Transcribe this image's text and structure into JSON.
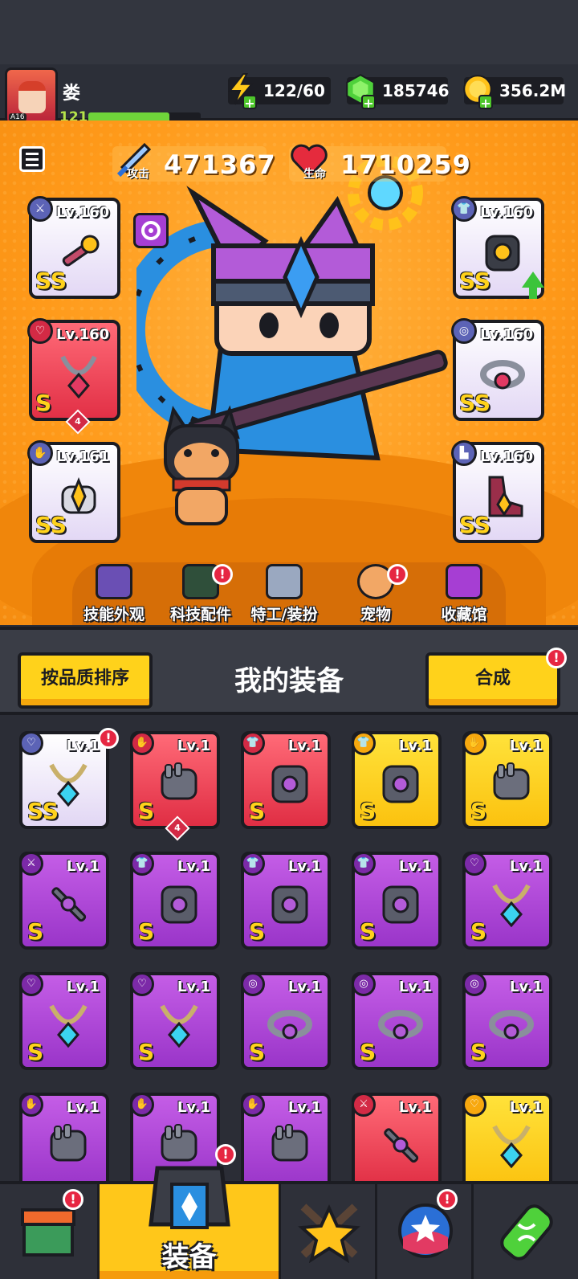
{
  "player": {
    "name": "娄",
    "level": "121",
    "avatar_badge": "A16",
    "xp_progress": 0.72
  },
  "resources": {
    "energy": "122/60",
    "gems": "185746",
    "coins": "356.2M"
  },
  "stats": {
    "attack_value": "471367",
    "attack_label": "攻击",
    "hp_value": "1710259",
    "hp_label": "生命"
  },
  "equipped": {
    "weapon": {
      "level": "Lv.160",
      "grade": "SS"
    },
    "necklace": {
      "level": "Lv.160",
      "grade": "S",
      "stars": "4"
    },
    "gloves": {
      "level": "Lv.161",
      "grade": "SS"
    },
    "armor": {
      "level": "Lv.160",
      "grade": "SS"
    },
    "belt": {
      "level": "Lv.160",
      "grade": "SS"
    },
    "boots": {
      "level": "Lv.160",
      "grade": "SS"
    }
  },
  "submenu": [
    {
      "label": "技能外观",
      "badge": ""
    },
    {
      "label": "科技配件",
      "badge": "!"
    },
    {
      "label": "特工/装扮",
      "badge": ""
    },
    {
      "label": "宠物",
      "badge": "!"
    },
    {
      "label": "收藏馆",
      "badge": ""
    }
  ],
  "equipment_section": {
    "title": "我的装备",
    "sort_button": "按品质排序",
    "merge_button": "合成",
    "merge_badge": "!"
  },
  "inventory": [
    {
      "level": "Lv.1",
      "grade": "SS",
      "rarity": "w",
      "item": "necklace-icon",
      "stars": "",
      "badge": "!"
    },
    {
      "level": "Lv.1",
      "grade": "S",
      "rarity": "r",
      "item": "gloves-icon",
      "stars": "4",
      "badge": ""
    },
    {
      "level": "Lv.1",
      "grade": "S",
      "rarity": "r",
      "item": "armor-icon",
      "stars": "",
      "badge": ""
    },
    {
      "level": "Lv.1",
      "grade": "S",
      "rarity": "y",
      "item": "armor-icon",
      "stars": "",
      "badge": ""
    },
    {
      "level": "Lv.1",
      "grade": "S",
      "rarity": "y",
      "item": "gloves-icon",
      "stars": "",
      "badge": ""
    },
    {
      "level": "Lv.1",
      "grade": "S",
      "rarity": "p",
      "item": "weapon-icon",
      "stars": "",
      "badge": ""
    },
    {
      "level": "Lv.1",
      "grade": "S",
      "rarity": "p",
      "item": "armor-icon",
      "stars": "",
      "badge": ""
    },
    {
      "level": "Lv.1",
      "grade": "S",
      "rarity": "p",
      "item": "armor-icon",
      "stars": "",
      "badge": ""
    },
    {
      "level": "Lv.1",
      "grade": "S",
      "rarity": "p",
      "item": "armor-icon",
      "stars": "",
      "badge": ""
    },
    {
      "level": "Lv.1",
      "grade": "S",
      "rarity": "p",
      "item": "necklace-icon",
      "stars": "",
      "badge": ""
    },
    {
      "level": "Lv.1",
      "grade": "S",
      "rarity": "p",
      "item": "necklace-icon",
      "stars": "",
      "badge": ""
    },
    {
      "level": "Lv.1",
      "grade": "S",
      "rarity": "p",
      "item": "necklace-icon",
      "stars": "",
      "badge": ""
    },
    {
      "level": "Lv.1",
      "grade": "S",
      "rarity": "p",
      "item": "belt-icon",
      "stars": "",
      "badge": ""
    },
    {
      "level": "Lv.1",
      "grade": "S",
      "rarity": "p",
      "item": "belt-icon",
      "stars": "",
      "badge": ""
    },
    {
      "level": "Lv.1",
      "grade": "S",
      "rarity": "p",
      "item": "belt-icon",
      "stars": "",
      "badge": ""
    },
    {
      "level": "Lv.1",
      "grade": "",
      "rarity": "p",
      "item": "gloves-icon",
      "stars": "",
      "badge": ""
    },
    {
      "level": "Lv.1",
      "grade": "",
      "rarity": "p",
      "item": "gloves-icon",
      "stars": "",
      "badge": ""
    },
    {
      "level": "Lv.1",
      "grade": "",
      "rarity": "p",
      "item": "gloves-icon",
      "stars": "",
      "badge": ""
    },
    {
      "level": "Lv.1",
      "grade": "",
      "rarity": "r",
      "item": "weapon-icon",
      "stars": "",
      "badge": ""
    },
    {
      "level": "Lv.1",
      "grade": "",
      "rarity": "y",
      "item": "necklace-icon",
      "stars": "",
      "badge": ""
    }
  ],
  "nav": {
    "equip_label": "装备",
    "shop_badge": "!",
    "equip_badge": "!",
    "talent_badge": "!"
  },
  "colors": {
    "stage_orange": "#ff9a1a",
    "rarity_purple": "#9a35c9",
    "rarity_red": "#e02e44",
    "rarity_yellow": "#fbc20f",
    "rarity_white": "#ffffff",
    "accent_yellow": "#ffd21b"
  }
}
